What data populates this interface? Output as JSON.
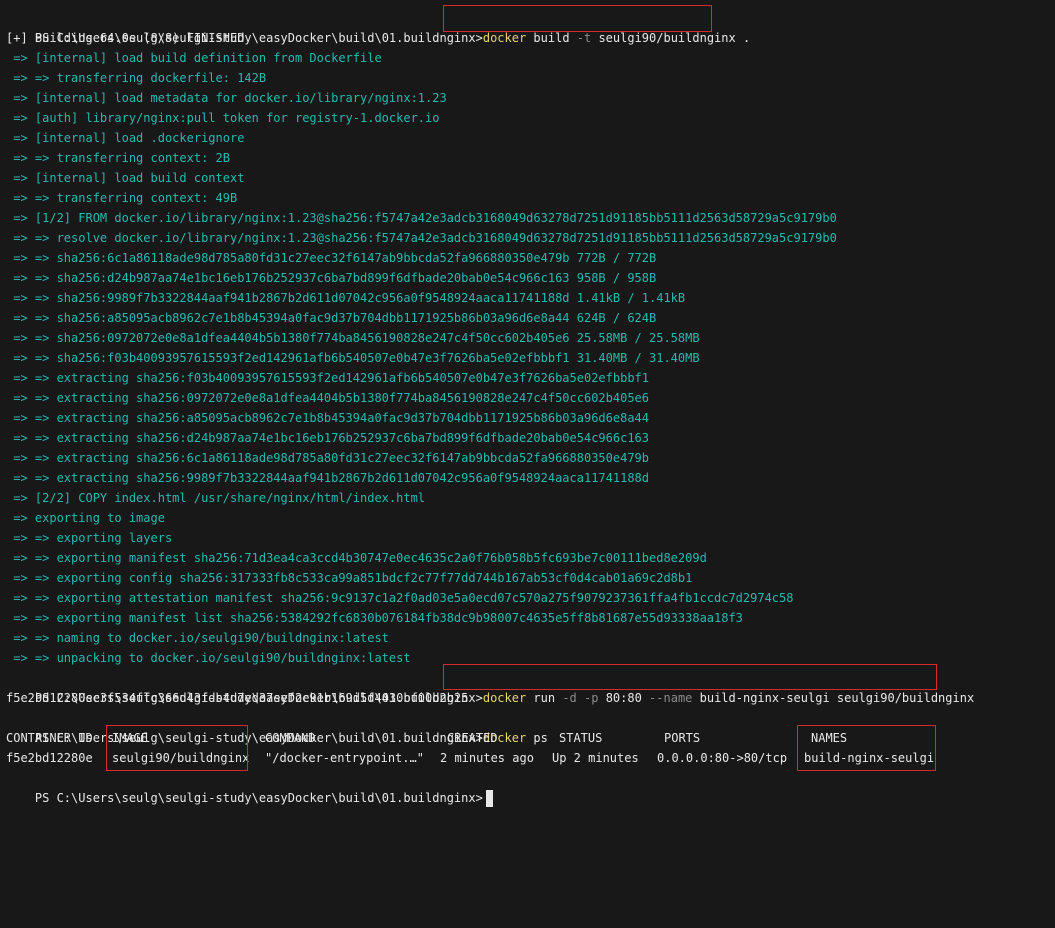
{
  "prompt": "PS C:\\Users\\seulg\\seulgi-study\\easyDocker\\build\\01.buildnginx>",
  "commands": {
    "build": {
      "name": "docker",
      "parts": [
        " build ",
        "-t",
        " seulgi90/buildnginx ."
      ]
    },
    "run": {
      "name": "docker",
      "parts": [
        " run ",
        "-d",
        " ",
        "-p",
        " 80:80 ",
        "--name",
        " build-nginx-seulgi seulgi90/buildnginx"
      ]
    },
    "ps": {
      "name": "docker",
      "rest": " ps"
    }
  },
  "build_status": "[+] Building 64.0s (8/8) FINISHED",
  "build_log": [
    " => [internal] load build definition from Dockerfile",
    " => => transferring dockerfile: 142B",
    " => [internal] load metadata for docker.io/library/nginx:1.23",
    " => [auth] library/nginx:pull token for registry-1.docker.io",
    " => [internal] load .dockerignore",
    " => => transferring context: 2B",
    " => [internal] load build context",
    " => => transferring context: 49B",
    " => [1/2] FROM docker.io/library/nginx:1.23@sha256:f5747a42e3adcb3168049d63278d7251d91185bb5111d2563d58729a5c9179b0",
    " => => resolve docker.io/library/nginx:1.23@sha256:f5747a42e3adcb3168049d63278d7251d91185bb5111d2563d58729a5c9179b0",
    " => => sha256:6c1a86118ade98d785a80fd31c27eec32f6147ab9bbcda52fa966880350e479b 772B / 772B",
    " => => sha256:d24b987aa74e1bc16eb176b252937c6ba7bd899f6dfbade20bab0e54c966c163 958B / 958B",
    " => => sha256:9989f7b3322844aaf941b2867b2d611d07042c956a0f9548924aaca11741188d 1.41kB / 1.41kB",
    " => => sha256:a85095acb8962c7e1b8b45394a0fac9d37b704dbb1171925b86b03a96d6e8a44 624B / 624B",
    " => => sha256:0972072e0e8a1dfea4404b5b1380f774ba8456190828e247c4f50cc602b405e6 25.58MB / 25.58MB",
    " => => sha256:f03b40093957615593f2ed142961afb6b540507e0b47e3f7626ba5e02efbbbf1 31.40MB / 31.40MB",
    " => => extracting sha256:f03b40093957615593f2ed142961afb6b540507e0b47e3f7626ba5e02efbbbf1",
    " => => extracting sha256:0972072e0e8a1dfea4404b5b1380f774ba8456190828e247c4f50cc602b405e6",
    " => => extracting sha256:a85095acb8962c7e1b8b45394a0fac9d37b704dbb1171925b86b03a96d6e8a44",
    " => => extracting sha256:d24b987aa74e1bc16eb176b252937c6ba7bd899f6dfbade20bab0e54c966c163",
    " => => extracting sha256:6c1a86118ade98d785a80fd31c27eec32f6147ab9bbcda52fa966880350e479b",
    " => => extracting sha256:9989f7b3322844aaf941b2867b2d611d07042c956a0f9548924aaca11741188d",
    " => [2/2] COPY index.html /usr/share/nginx/html/index.html",
    " => exporting to image",
    " => => exporting layers",
    " => => exporting manifest sha256:71d3ea4ca3ccd4b30747e0ec4635c2a0f76b058b5fc693be7c00111bed8e209d",
    " => => exporting config sha256:317333fb8c533ca99a851bdcf2c77f77dd744b167ab53cf0d4cab01a69c2d8b1",
    " => => exporting attestation manifest sha256:9c9137c1a2f0ad03e5a0ecd07c570a275f9079237361ffa4fb1ccdc7d2974c58",
    " => => exporting manifest list sha256:5384292fc6830b076184fb38dc9b98007c4635e5ff8b81687e55d93338aa18f3",
    " => => naming to docker.io/seulgi90/buildnginx:latest",
    " => => unpacking to docker.io/seulgi90/buildnginx:latest"
  ],
  "run_output": "f5e2bd12280ec3f534ffc366d43fdb4d7ed37eef2e91b169d5f4430bf00b2b25",
  "ps_table": {
    "headers": [
      "CONTAINER ID",
      "IMAGE",
      "COMMAND",
      "CREATED",
      "STATUS",
      "PORTS",
      "NAMES"
    ],
    "rows": [
      [
        "f5e2bd12280e",
        "seulgi90/buildnginx",
        "\"/docker-entrypoint.…\"",
        "2 minutes ago",
        "Up 2 minutes",
        "0.0.0.0:80->80/tcp",
        "build-nginx-seulgi"
      ]
    ]
  },
  "colors": {
    "background": "#181818",
    "text": "#e8e8e8",
    "command": "#e6d36a",
    "flag": "#8a8a8a",
    "build_log": "#26b9b0",
    "highlight_box": "#d62b2b"
  }
}
